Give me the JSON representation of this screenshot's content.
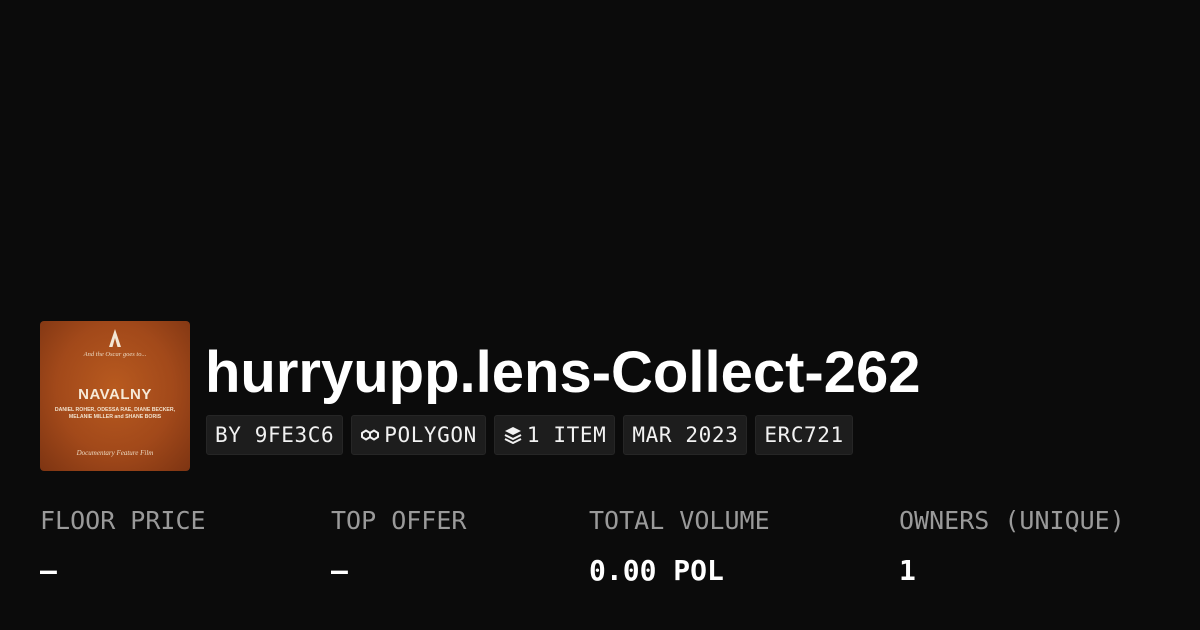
{
  "collection": {
    "title": "hurryupp.lens-Collect-262",
    "image": {
      "tagline": "And the Oscar goes to...",
      "film_title": "NAVALNY",
      "credits_line1": "DANIEL ROHER, ODESSA RAE, DIANE BECKER,",
      "credits_line2": "MELANIE MILLER and SHANE BORIS",
      "category": "Documentary Feature Film",
      "icon": "oscar-statuette-icon"
    }
  },
  "badges": [
    {
      "label": "BY 9FE3C6"
    },
    {
      "label": "POLYGON",
      "icon": "polygon-chain-icon"
    },
    {
      "label": "1 ITEM",
      "icon": "layers-icon"
    },
    {
      "label": "MAR 2023"
    },
    {
      "label": "ERC721"
    }
  ],
  "stats": [
    {
      "label": "FLOOR PRICE",
      "value": "–"
    },
    {
      "label": "TOP OFFER",
      "value": "–"
    },
    {
      "label": "TOTAL VOLUME",
      "value": "0.00 POL"
    },
    {
      "label": "OWNERS (UNIQUE)",
      "value": "1"
    }
  ],
  "colors": {
    "background": "#0b0b0b",
    "badge_background": "#1d1d1d",
    "label": "#9a9a9a",
    "text": "#ffffff",
    "thumbnail": "#a2491a"
  }
}
